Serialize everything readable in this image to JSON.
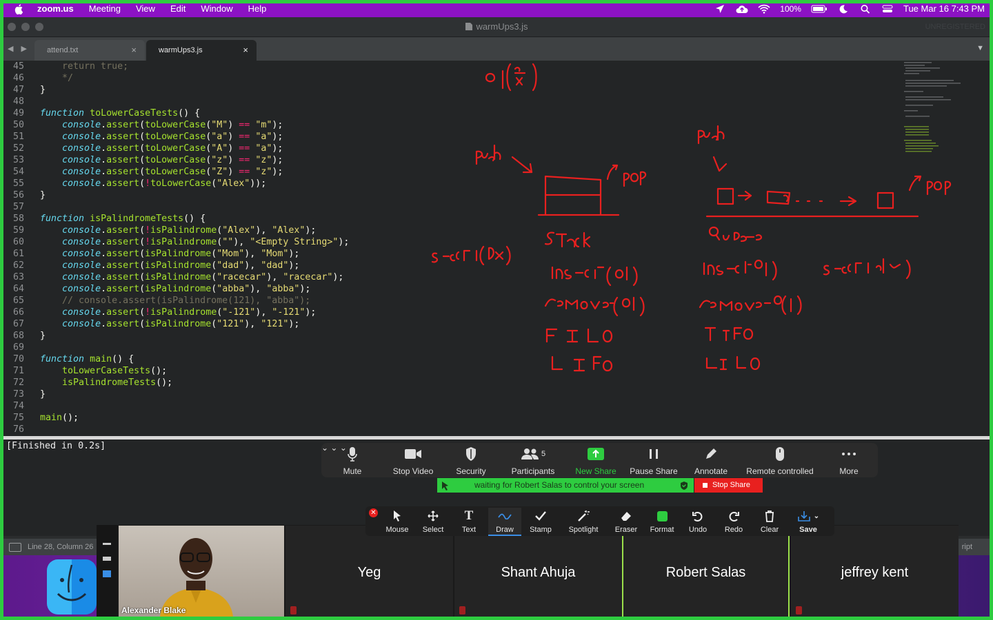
{
  "menubar": {
    "app": "zoom.us",
    "items": [
      "Meeting",
      "View",
      "Edit",
      "Window",
      "Help"
    ],
    "battery": "100%",
    "datetime": "Tue Mar 16  7:43 PM"
  },
  "window": {
    "title": "warmUps3.js",
    "unregistered": "UNREGISTERED"
  },
  "tabs": [
    {
      "label": "attend.txt",
      "close": "×"
    },
    {
      "label": "warmUps3.js",
      "close": "×"
    }
  ],
  "editor": {
    "line_numbers": [
      "45",
      "46",
      "47",
      "48",
      "49",
      "50",
      "51",
      "52",
      "53",
      "54",
      "55",
      "56",
      "57",
      "58",
      "59",
      "60",
      "61",
      "62",
      "63",
      "64",
      "65",
      "66",
      "67",
      "68",
      "69",
      "70",
      "71",
      "72",
      "73",
      "74",
      "75",
      "76"
    ]
  },
  "output": {
    "text": "[Finished in 0.2s]"
  },
  "statusbar": {
    "position": "Line 28, Column 26",
    "syntax": "ript"
  },
  "zoom_toolbar": {
    "mute": "Mute",
    "stop_video": "Stop Video",
    "security": "Security",
    "participants": "Participants",
    "participants_count": "5",
    "new_share": "New Share",
    "pause_share": "Pause Share",
    "annotate": "Annotate",
    "remote_controlled": "Remote controlled",
    "more": "More",
    "waiting": "waiting for Robert Salas to control your screen",
    "stop_share": "Stop Share"
  },
  "annotate_toolbar": {
    "mouse": "Mouse",
    "select": "Select",
    "text": "Text",
    "draw": "Draw",
    "stamp": "Stamp",
    "spotlight": "Spotlight",
    "eraser": "Eraser",
    "format": "Format",
    "undo": "Undo",
    "redo": "Redo",
    "clear": "Clear",
    "save": "Save",
    "format_color": "#2ecc40"
  },
  "participants": {
    "self": "Alexander Blake",
    "tiles": [
      "Yeg",
      "Shant Ahuja",
      "Robert Salas",
      "jeffrey kent"
    ]
  },
  "colors": {
    "share_border": "#2ecc40",
    "menubar": "#8c12c4",
    "annotation": "#e8201f"
  }
}
